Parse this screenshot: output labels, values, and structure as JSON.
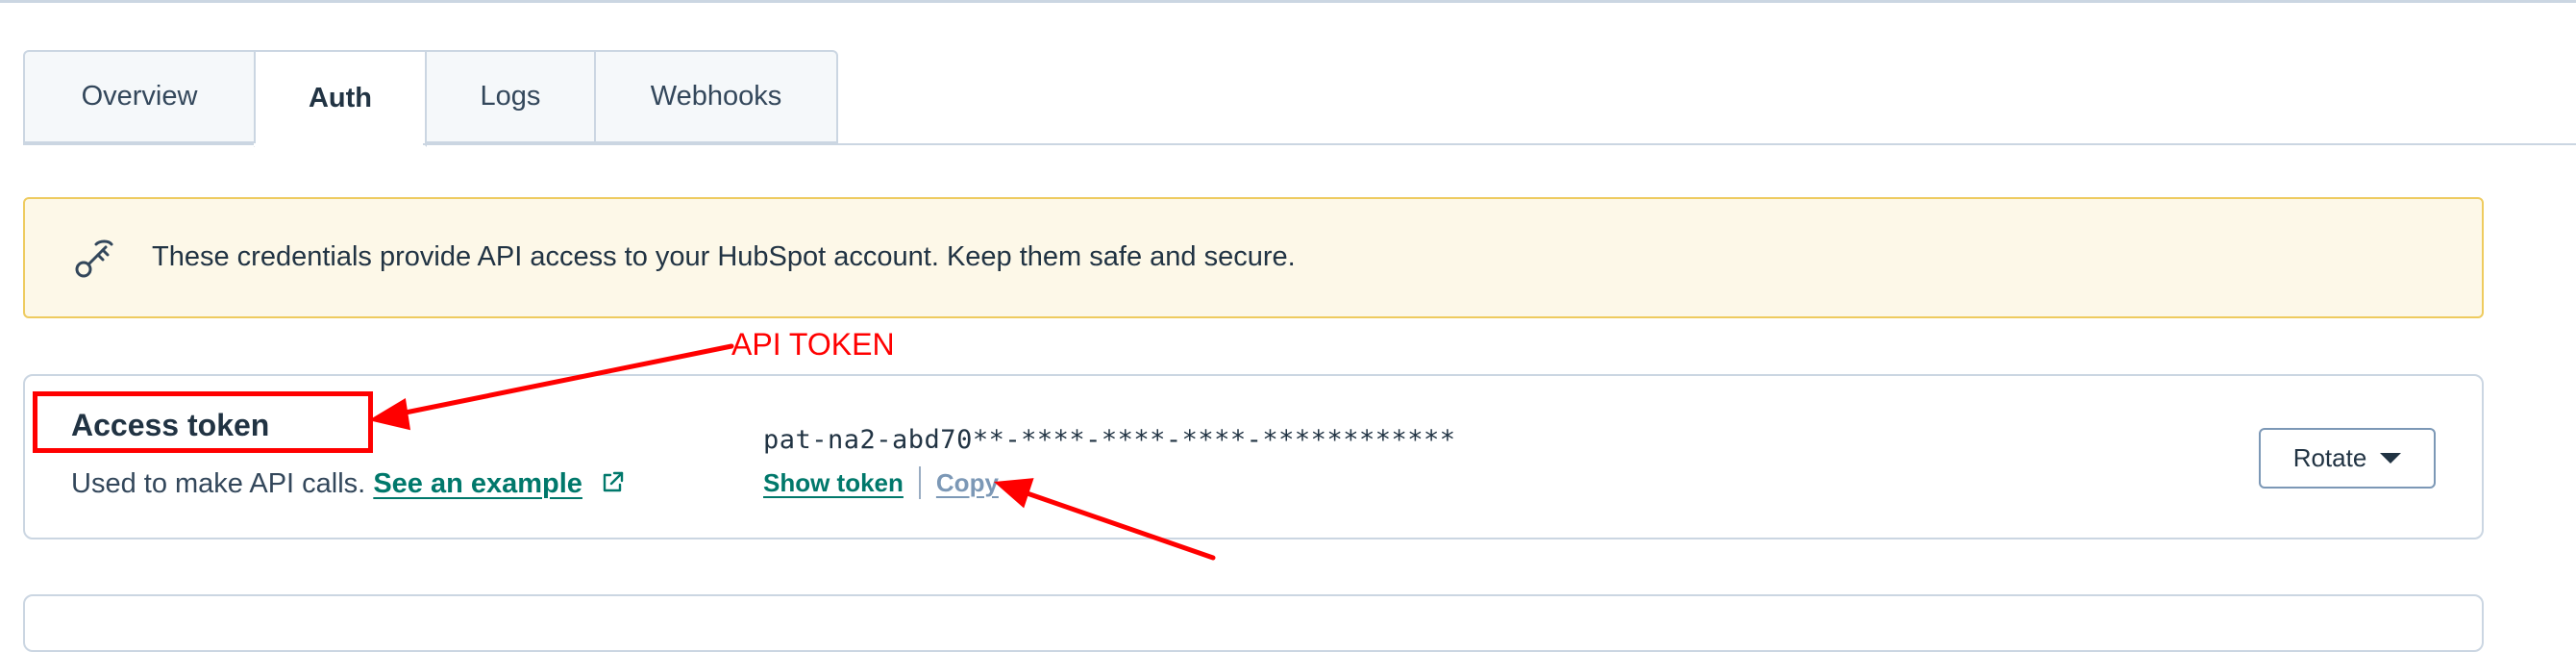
{
  "tabs": [
    {
      "label": "Overview",
      "active": false
    },
    {
      "label": "Auth",
      "active": true
    },
    {
      "label": "Logs",
      "active": false
    },
    {
      "label": "Webhooks",
      "active": false
    }
  ],
  "alert": {
    "icon": "key-icon",
    "text": "These credentials provide API access to your HubSpot account. Keep them safe and secure."
  },
  "access_token": {
    "title": "Access token",
    "description": "Used to make API calls.",
    "example_link": "See an example",
    "token_value": "pat-na2-abd70**-****-****-****-************",
    "show_label": "Show token",
    "copy_label": "Copy",
    "rotate_label": "Rotate"
  },
  "annotation": {
    "label": "API TOKEN",
    "color": "#ff0000"
  },
  "colors": {
    "link": "#00786b",
    "alert_bg": "#fdf8e8",
    "alert_border": "#eecb5f",
    "border": "#cbd6e2"
  }
}
